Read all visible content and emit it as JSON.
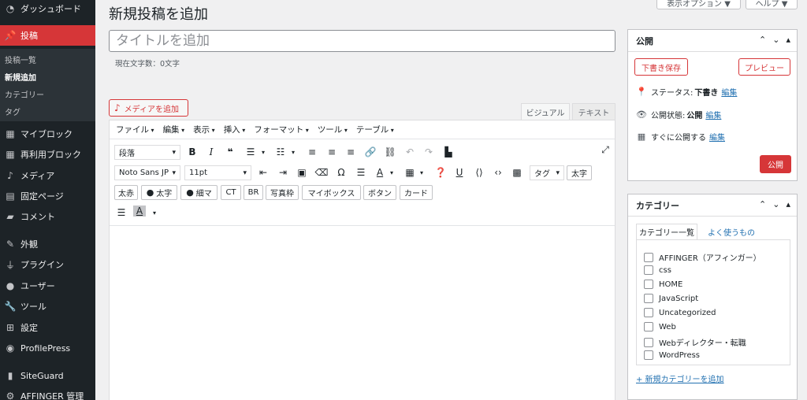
{
  "sidebar": {
    "items": [
      {
        "label": "ダッシュボード",
        "icon": "dashboard-icon"
      },
      {
        "label": "投稿",
        "icon": "pin-icon"
      },
      {
        "label": "マイブロック",
        "icon": "blocks-icon"
      },
      {
        "label": "再利用ブロック",
        "icon": "blocks-icon"
      },
      {
        "label": "メディア",
        "icon": "media-icon"
      },
      {
        "label": "固定ページ",
        "icon": "page-icon"
      },
      {
        "label": "コメント",
        "icon": "comment-icon"
      },
      {
        "label": "外観",
        "icon": "brush-icon"
      },
      {
        "label": "プラグイン",
        "icon": "plugin-icon"
      },
      {
        "label": "ユーザー",
        "icon": "user-icon"
      },
      {
        "label": "ツール",
        "icon": "wrench-icon"
      },
      {
        "label": "設定",
        "icon": "settings-icon"
      },
      {
        "label": "ProfilePress",
        "icon": "profilepress-icon"
      },
      {
        "label": "SiteGuard",
        "icon": "siteguard-icon"
      },
      {
        "label": "AFFINGER 管理",
        "icon": "gear-icon"
      }
    ],
    "submenu": [
      "投稿一覧",
      "新規追加",
      "カテゴリー",
      "タグ"
    ]
  },
  "top_buttons": {
    "screen_options": "表示オプション ▼",
    "help": "ヘルプ ▼"
  },
  "page_title": "新規投稿を追加",
  "title_input": {
    "placeholder": "タイトルを追加"
  },
  "char_count": "現在文字数：0文字",
  "media_button": "メディアを追加",
  "editor_tabs": {
    "visual": "ビジュアル",
    "text": "テキスト"
  },
  "menubar": [
    "ファイル",
    "編集",
    "表示",
    "挿入",
    "フォーマット",
    "ツール",
    "テーブル"
  ],
  "toolbar": {
    "format_select": "段落",
    "font_select": "Noto Sans JP",
    "size_select": "11pt",
    "tag_select": "タグ",
    "buttons_row2": {
      "futoji": "太字"
    },
    "buttons_row3": {
      "futoaka": "太赤",
      "futoji2": "太字",
      "hosoma": "細マ",
      "ct": "CT",
      "br": "BR",
      "photo_frame": "写真枠",
      "mybox": "マイボックス",
      "button": "ボタン",
      "card": "カード"
    }
  },
  "publish_panel": {
    "title": "公開",
    "save_draft": "下書き保存",
    "preview": "プレビュー",
    "status_label": "ステータス:",
    "status_value": "下書き",
    "visibility_label": "公開状態:",
    "visibility_value": "公開",
    "schedule_label": "すぐに公開する",
    "edit_link": "編集",
    "publish_button": "公開"
  },
  "category_panel": {
    "title": "カテゴリー",
    "tab_all": "カテゴリー一覧",
    "tab_popular": "よく使うもの",
    "categories": [
      "AFFINGER（アフィンガー）",
      "css",
      "HOME",
      "JavaScript",
      "Uncategorized",
      "Web",
      "Webディレクター・転職",
      "WordPress"
    ],
    "add_new": "+ 新規カテゴリーを追加"
  },
  "colors": {
    "accent": "#d63638",
    "sidebar_bg": "#1d2327",
    "link": "#2271b1"
  }
}
